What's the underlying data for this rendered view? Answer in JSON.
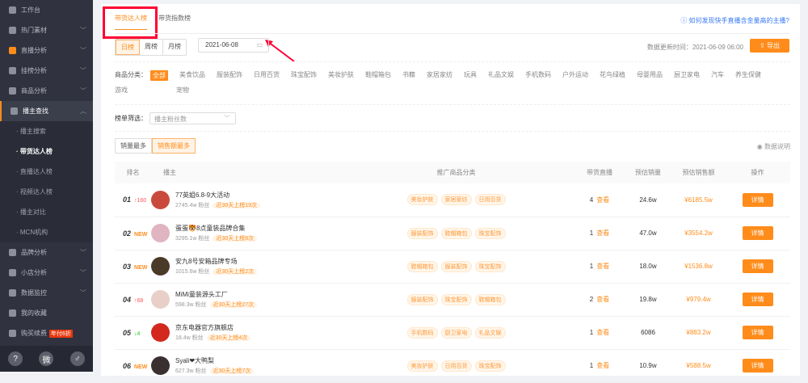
{
  "sidebar": {
    "items": [
      {
        "label": "工作台",
        "chev": false
      },
      {
        "label": "热门素材",
        "chev": true
      },
      {
        "label": "直播分析",
        "chev": true
      },
      {
        "label": "挂榜分析",
        "chev": true
      },
      {
        "label": "商品分析",
        "chev": true
      },
      {
        "label": "播主查找",
        "chev": true,
        "active": true
      }
    ],
    "sub": [
      "播主搜索",
      "带货达人榜",
      "直播达人榜",
      "视频达人榜",
      "播主对比",
      "MCN机构"
    ],
    "items2": [
      {
        "label": "品牌分析"
      },
      {
        "label": "小店分析"
      },
      {
        "label": "数据监控"
      },
      {
        "label": "我的收藏"
      },
      {
        "label": "购买续费"
      }
    ],
    "badge": "年付6折",
    "footer": [
      "?",
      "微",
      "♂"
    ]
  },
  "tabs": [
    "带货达人榜",
    "带货指数榜"
  ],
  "help": "如何发现快手直播含金量高的主播?",
  "period": [
    "日榜",
    "周榜",
    "月榜"
  ],
  "date": "2021-06-08",
  "update": "数据更新时间：2021-06-09 06:00",
  "export": "导出",
  "cat_label": "商品分类：",
  "cats": [
    "全部",
    "美食饮品",
    "服装配饰",
    "日用百货",
    "珠宝配饰",
    "美妆护肤",
    "鞋帽箱包",
    "书籍",
    "家居家纺",
    "玩具",
    "礼品文娱",
    "手机数码",
    "户外运动",
    "花鸟绿植",
    "母婴用品",
    "厨卫家电",
    "汽车",
    "养生保健",
    "游戏",
    "宠物"
  ],
  "filter_label": "榜单筛选：",
  "filter_value": "播主粉丝数",
  "sort": [
    "销量最多",
    "销售额最多"
  ],
  "explain": "数据说明",
  "headers": [
    "排名",
    "播主",
    "推广商品分类",
    "带货直播",
    "预估销量",
    "预估销售额",
    "操作"
  ],
  "rows": [
    {
      "rank": "01",
      "change": "↑160",
      "ctype": "up",
      "name": "77英姐6.8-9大活动",
      "fans": "2745.4w 粉丝",
      "tip": "近30天上榜19次",
      "tags": [
        "美妆护肤",
        "家居家纺",
        "日用百货"
      ],
      "live": "4",
      "vol": "24.6w",
      "amt": "¥6185.5w",
      "color": "#c94a3c"
    },
    {
      "rank": "02",
      "change": "NEW",
      "ctype": "new",
      "name": "蛋蛋🐯8点童装品牌合集",
      "fans": "3295.1w 粉丝",
      "tip": "近30天上榜8次",
      "tags": [
        "服装配饰",
        "鞋帽箱包",
        "珠宝配饰"
      ],
      "live": "1",
      "vol": "47.0w",
      "amt": "¥3554.2w",
      "color": "#e0b4c0"
    },
    {
      "rank": "03",
      "change": "NEW",
      "ctype": "new",
      "name": "安九8号安箱品牌专场",
      "fans": "1015.6w 粉丝",
      "tip": "近30天上榜2次",
      "tags": [
        "鞋帽箱包",
        "服装配饰",
        "珠宝配饰"
      ],
      "live": "1",
      "vol": "18.0w",
      "amt": "¥1536.8w",
      "color": "#4a3a28"
    },
    {
      "rank": "04",
      "change": "↑68",
      "ctype": "up",
      "name": "MiMi童装源头工厂",
      "fans": "598.3w 粉丝",
      "tip": "近30天上榜27次",
      "tags": [
        "服装配饰",
        "珠宝配饰",
        "鞋帽箱包"
      ],
      "live": "2",
      "vol": "19.8w",
      "amt": "¥979.4w",
      "color": "#e8d0c8"
    },
    {
      "rank": "05",
      "change": "↓4",
      "ctype": "down",
      "name": "京东电器官方旗舰店",
      "fans": "18.4w 粉丝",
      "tip": "近30天上榜4次",
      "tags": [
        "手机数码",
        "厨卫家电",
        "礼品文娱"
      ],
      "live": "1",
      "vol": "6086",
      "amt": "¥883.2w",
      "color": "#d2281e"
    },
    {
      "rank": "06",
      "change": "NEW",
      "ctype": "new",
      "name": "Syali❤大鸭梨",
      "fans": "627.3w 粉丝",
      "tip": "近30天上榜7次",
      "tags": [
        "美妆护肤",
        "日用百货",
        "珠宝配饰"
      ],
      "live": "1",
      "vol": "10.9w",
      "amt": "¥588.5w",
      "color": "#3a3030"
    }
  ],
  "look": "查看",
  "detail": "详情"
}
